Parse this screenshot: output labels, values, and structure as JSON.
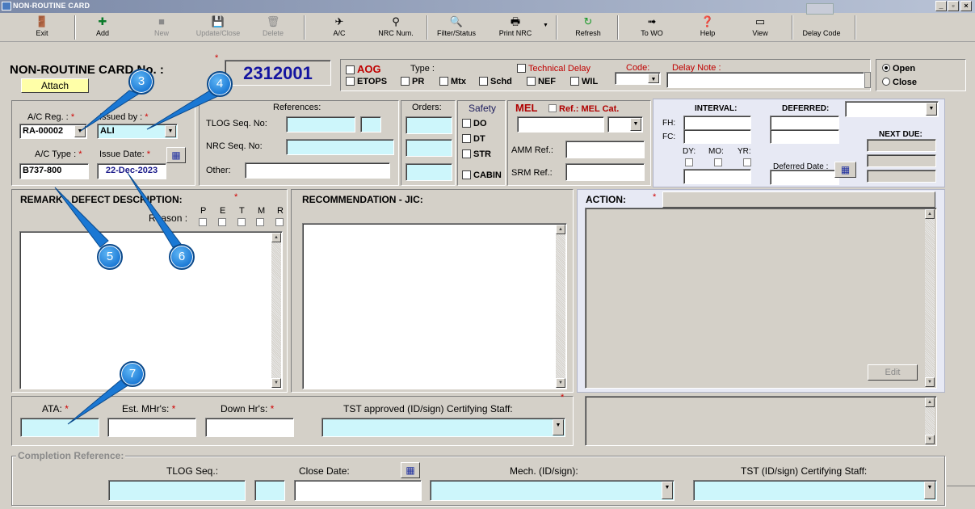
{
  "window": {
    "title": "NON-ROUTINE CARD",
    "min": "_",
    "max": "▫",
    "close": "×"
  },
  "toolbar": [
    {
      "label": "Exit",
      "icon": "🚪"
    },
    {
      "label": "Add",
      "icon": "✚"
    },
    {
      "label": "New",
      "icon": "■"
    },
    {
      "label": "Update/Close",
      "icon": "💾"
    },
    {
      "label": "Delete",
      "icon": "🗑"
    },
    {
      "label": "A/C",
      "icon": "✈"
    },
    {
      "label": "NRC Num.",
      "icon": "⚲"
    },
    {
      "label": "Filter/Status",
      "icon": "🔍"
    },
    {
      "label": "Print NRC",
      "icon": "🖶"
    },
    {
      "label": "Refresh",
      "icon": "↻"
    },
    {
      "label": "To WO",
      "icon": "➟"
    },
    {
      "label": "Help",
      "icon": "❓"
    },
    {
      "label": "View",
      "icon": "▭"
    },
    {
      "label": "Delay Code",
      "icon": ""
    }
  ],
  "header": {
    "title": "NON-ROUTINE CARD No. :",
    "card_no": "2312001",
    "attach": "Attach",
    "aog": "AOG",
    "etops": "ETOPS",
    "type_label": "Type :",
    "pr": "PR",
    "mtx": "Mtx",
    "schd": "Schd",
    "nef": "NEF",
    "wil": "WIL",
    "tech_delay": "Technical Delay",
    "code_label": "Code:",
    "delay_note_label": "Delay Note :",
    "open": "Open",
    "close": "Close",
    "req": "*"
  },
  "aircraft": {
    "ac_reg_label": "A/C Reg. :",
    "ac_reg": "RA-00002",
    "issued_by_label": "Issued by :",
    "issued_by": "ALI",
    "ac_type_label": "A/C Type :",
    "ac_type": "B737-800",
    "issue_date_label": "Issue Date:",
    "issue_date": "22-Dec-2023"
  },
  "references": {
    "title": "References:",
    "tlog": "TLOG Seq. No:",
    "nrc": "NRC Seq. No:",
    "other": "Other:",
    "orders": "Orders:",
    "safety": "Safety",
    "do": "DO",
    "dt": "DT",
    "str": "STR",
    "cabin": "CABIN"
  },
  "mel": {
    "mel": "MEL",
    "ref_cat": "Ref.: MEL Cat.",
    "amm": "AMM Ref.:",
    "srm": "SRM Ref.:"
  },
  "interval": {
    "interval": "INTERVAL:",
    "deferred": "DEFERRED:",
    "fh": "FH:",
    "fc": "FC:",
    "dy": "DY:",
    "mo": "MO:",
    "yr": "YR:",
    "deferred_date": "Deferred Date :",
    "next_due": "NEXT DUE:"
  },
  "remark": {
    "title": "REMARK - DEFECT DESCRIPTION:",
    "reason": "Reason :",
    "reasons": [
      "P",
      "E",
      "T",
      "M",
      "R"
    ]
  },
  "recommendation": {
    "title": "RECOMMENDATION - JIC:"
  },
  "action": {
    "title": "ACTION:",
    "edit": "Edit"
  },
  "bottom": {
    "ata": "ATA:",
    "est": "Est. MHr's:",
    "down": "Down Hr's:",
    "tst": "TST approved (ID/sign) Certifying Staff:"
  },
  "completion": {
    "title": "Completion Reference:",
    "tlog": "TLOG Seq.:",
    "close_date": "Close Date:",
    "mech": "Mech. (ID/sign):",
    "tst": "TST (ID/sign) Certifying Staff:"
  },
  "callouts": [
    "3",
    "4",
    "5",
    "6",
    "7"
  ],
  "colors": {
    "field_cyan": "#cdf6fb",
    "panel_blue": "#e7e9f4",
    "callout_blue": "#1a78d4",
    "card_no": "#1414a0"
  }
}
